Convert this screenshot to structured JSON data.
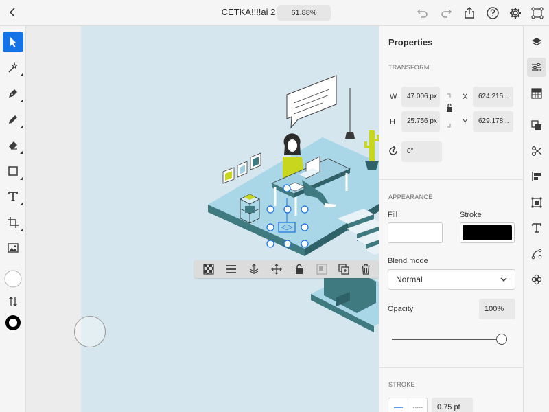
{
  "header": {
    "document_title": "CETKA!!!!ai 2",
    "zoom_level": "61.88%"
  },
  "icons": {
    "back": "chevron-left-icon",
    "undo": "undo-icon",
    "redo": "redo-icon",
    "share": "share-icon",
    "help": "help-icon",
    "settings": "gear-icon"
  },
  "tools": [
    "selection-tool",
    "direct-selection-tool",
    "pen-tool",
    "pencil-tool",
    "eraser-tool",
    "rectangle-tool",
    "type-tool",
    "crop-tool",
    "place-image-tool",
    "fill-swatch",
    "swap-fill-stroke",
    "stroke-swatch"
  ],
  "context_bar": [
    "transparency-grid-icon",
    "align-icon",
    "arrange-icon",
    "move-icon",
    "lock-icon",
    "group-icon",
    "duplicate-icon",
    "delete-icon"
  ],
  "properties": {
    "title": "Properties",
    "transform": {
      "label": "TRANSFORM",
      "w_label": "W",
      "w_value": "47.006 px",
      "h_label": "H",
      "h_value": "25.756 px",
      "x_label": "X",
      "x_value": "624.215...",
      "y_label": "Y",
      "y_value": "629.178...",
      "rotation_value": "0°"
    },
    "appearance": {
      "label": "APPEARANCE",
      "fill_label": "Fill",
      "fill_color": "#ffffff",
      "stroke_label": "Stroke",
      "stroke_color": "#000000",
      "blend_label": "Blend mode",
      "blend_value": "Normal",
      "opacity_label": "Opacity",
      "opacity_value": "100%",
      "opacity_fraction": 1.0
    },
    "stroke": {
      "label": "STROKE",
      "weight_value": "0.75 pt"
    }
  },
  "right_rail": [
    "layers-icon",
    "properties-icon",
    "swatches-icon",
    "pathfinder-icon",
    "cut-icon",
    "align-panel-icon",
    "transform-panel-icon",
    "type-panel-icon",
    "path-icon",
    "symbols-icon"
  ],
  "colors": {
    "accent": "#1473e6",
    "artboard_bg": "#d6e6ee",
    "illustration_teal": "#3f7a80",
    "illustration_light_blue": "#9fcfe0",
    "illustration_lime": "#c8d61e"
  }
}
